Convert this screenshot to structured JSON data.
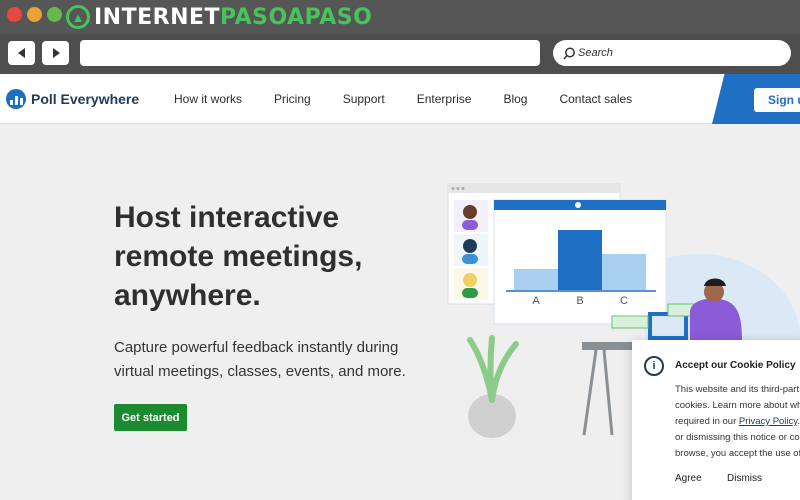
{
  "browser": {
    "watermark_left": "INTERNET",
    "watermark_right": "PASOAPASO",
    "search_placeholder": "Search"
  },
  "site": {
    "logo_text": "Poll Everywhere",
    "nav": [
      "How it works",
      "Pricing",
      "Support",
      "Enterprise",
      "Blog",
      "Contact sales"
    ],
    "signup_label": "Sign up"
  },
  "hero": {
    "title_lines": [
      "Host interactive",
      "remote meetings,",
      "anywhere."
    ],
    "subtitle_lines": [
      "Capture powerful feedback instantly during",
      "virtual meetings, classes, events, and more."
    ],
    "cta_label": "Get started"
  },
  "illustration": {
    "chart_categories": [
      "A",
      "B",
      "C"
    ],
    "chart_values": [
      0.35,
      1.0,
      0.6
    ],
    "colors": {
      "bar_light": "#a9d0f0",
      "bar_dark": "#1f6fc5",
      "accent_purple": "#8c5bd8",
      "plant_green": "#8ccc8a"
    }
  },
  "cookie": {
    "title": "Accept our Cookie Policy",
    "body_lines": [
      "This website and its third-part",
      "cookies. Learn more about wh",
      "required in our ",
      "or dismissing this notice or co",
      "browse, you accept the use of"
    ],
    "privacy_link": "Privacy Policy",
    "agree_label": "Agree",
    "dismiss_label": "Dismiss"
  },
  "colors": {
    "accent": "#1f6fc5",
    "cta": "#1c8a2e",
    "chrome": "#565656"
  }
}
